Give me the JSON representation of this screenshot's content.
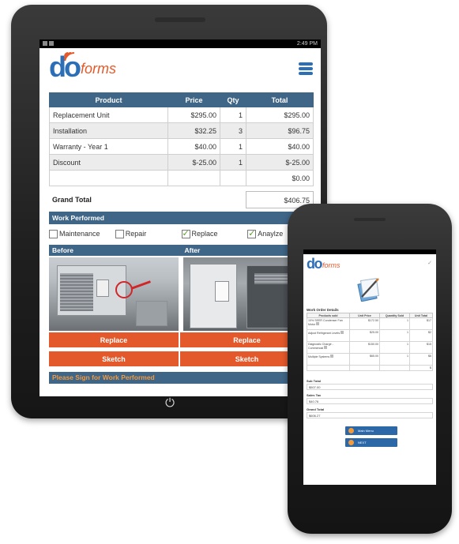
{
  "tablet": {
    "status_time": "2:49 PM",
    "logo": {
      "do": "do",
      "forms": "forms"
    },
    "table": {
      "headers": [
        "Product",
        "Price",
        "Qty",
        "Total"
      ],
      "rows": [
        [
          "Replacement Unit",
          "$295.00",
          "1",
          "$295.00"
        ],
        [
          "Installation",
          "$32.25",
          "3",
          "$96.75"
        ],
        [
          "Warranty - Year 1",
          "$40.00",
          "1",
          "$40.00"
        ],
        [
          "Discount",
          "$-25.00",
          "1",
          "$-25.00"
        ],
        [
          "",
          "",
          "",
          "$0.00"
        ]
      ]
    },
    "grand_total_label": "Grand Total",
    "grand_total_value": "$406.75",
    "work_performed_label": "Work Performed",
    "checkboxes": [
      {
        "label": "Maintenance",
        "checked": false
      },
      {
        "label": "Repair",
        "checked": false
      },
      {
        "label": "Replace",
        "checked": true
      },
      {
        "label": "Anaylze",
        "checked": true
      }
    ],
    "before_label": "Before",
    "after_label": "After",
    "replace_label": "Replace",
    "sketch_label": "Sketch",
    "sign_label": "Please Sign for Work Performed"
  },
  "phone": {
    "logo": {
      "do": "do",
      "forms": "forms"
    },
    "section_title": "Work Order Details",
    "table": {
      "headers": [
        "Products sold",
        "Unit Price",
        "Quantity Sold",
        "Unit Total"
      ],
      "rows": [
        [
          "10% SEER Condenser Fan Motor",
          "$172.50",
          "1",
          "$17"
        ],
        [
          "Adjust Refrigerant Levels",
          "$25.00",
          "1",
          "$2"
        ],
        [
          "Diagnostic Charge - Commercial",
          "$150.00",
          "1",
          "$15"
        ],
        [
          "Multiple Systems",
          "$65.00",
          "1",
          "$6"
        ],
        [
          "",
          "",
          "",
          "$"
        ]
      ]
    },
    "subtotal_label": "Sub Total",
    "subtotal_value": "$507.00",
    "tax_label": "Sales Tax",
    "tax_value": "$40.76",
    "grand_label": "Grand Total",
    "grand_value": "$606.27",
    "main_menu_label": "Main Menu",
    "next_label": "NEXT"
  },
  "colors": {
    "brand_blue": "#2c6fb7",
    "header_blue": "#3f6587",
    "orange": "#e4592b"
  }
}
